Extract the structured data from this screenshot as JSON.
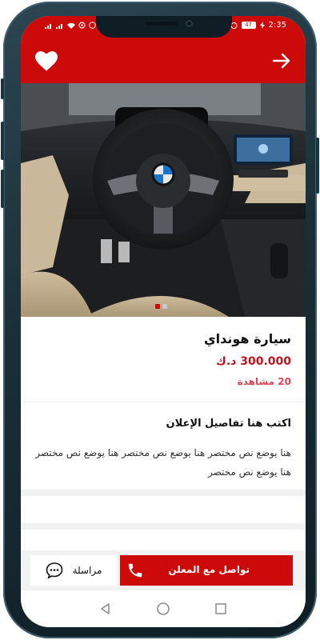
{
  "status_bar": {
    "left_icons": [
      "signal-icon",
      "signal-icon",
      "wifi-icon",
      "hotspot-icon",
      "whatsapp-icon",
      "sim-icon"
    ],
    "battery": "47",
    "time": "2:35"
  },
  "header": {
    "favorite_icon": "heart-icon",
    "back_icon": "arrow-right-icon",
    "accent_color": "#cc0a0a"
  },
  "gallery": {
    "image": "car-interior-steering-wheel",
    "slides": 2,
    "active_slide": 1
  },
  "listing": {
    "title": "سيارة هونداي",
    "price": "300.000 د.ك",
    "views": "20 مشاهدة"
  },
  "details": {
    "heading": "اكتب هنا تفاصيل الإعلان",
    "description": "هنا يوضع نص مختصر هنا يوضع نص مختصر هنا يوضع نص مختصر هنا يوضع نص مختصر"
  },
  "actions": {
    "contact_label": "تواصل مع المعلن",
    "message_label": "مراسلة",
    "contact_icon": "phone-icon",
    "message_icon": "chat-icon"
  },
  "system_nav": {
    "icons": [
      "back-triangle-icon",
      "home-circle-icon",
      "recents-square-icon"
    ]
  }
}
